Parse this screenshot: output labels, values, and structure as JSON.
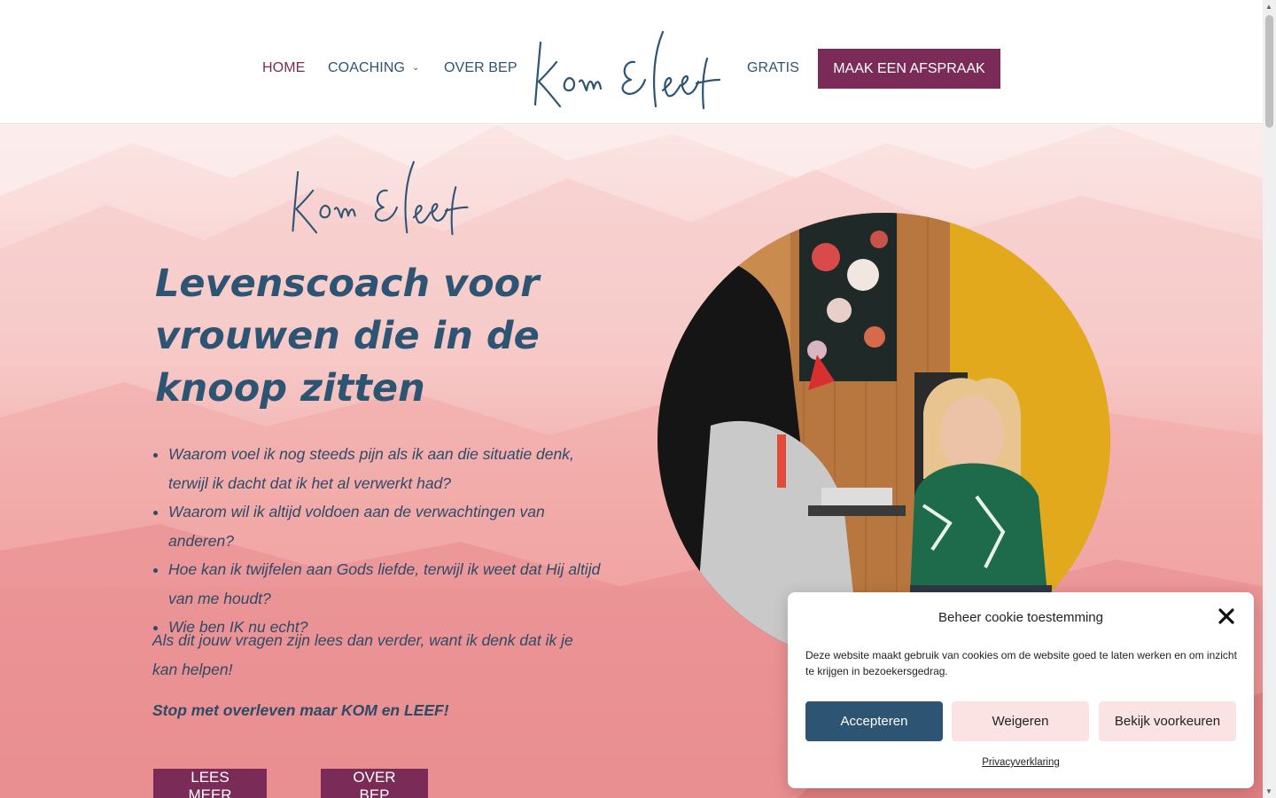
{
  "nav": {
    "home": "HOME",
    "coaching": "COACHING",
    "over_bep": "OVER BEP",
    "gratis": "GRATIS",
    "cta": "MAAK EEN AFSPRAAK",
    "chevron": "chevron-down-icon"
  },
  "logo": {
    "text": "Kom & Leef"
  },
  "hero": {
    "title": "Levenscoach voor vrouwen die in de knoop zitten",
    "questions": [
      "Waarom voel ik nog steeds pijn als ik aan die situatie denk, terwijl ik dacht dat ik het al verwerkt had?",
      "Waarom wil ik altijd voldoen aan de verwachtingen van anderen?",
      "Hoe kan ik twijfelen aan Gods liefde, terwijl ik weet dat Hij altijd van me houdt?",
      "Wie ben IK nu echt?"
    ],
    "paragraph": "Als dit jouw vragen zijn lees dan verder, want ik denk dat ik je kan helpen!",
    "tagline": "Stop met overleven maar KOM en LEEF!",
    "btn_lees": "LEES MEER",
    "btn_over": "OVER BEP"
  },
  "cookie": {
    "title": "Beheer cookie toestemming",
    "text": "Deze website maakt gebruik van cookies om de website goed te laten werken en om inzicht te krijgen in bezoekersgedrag.",
    "accept": "Accepteren",
    "deny": "Weigeren",
    "prefs": "Bekijk voorkeuren",
    "privacy": "Privacyverklaring"
  },
  "colors": {
    "brand_plum": "#7a2b57",
    "brand_navy": "#2d5573",
    "cookie_soft": "#fbe3e3"
  }
}
